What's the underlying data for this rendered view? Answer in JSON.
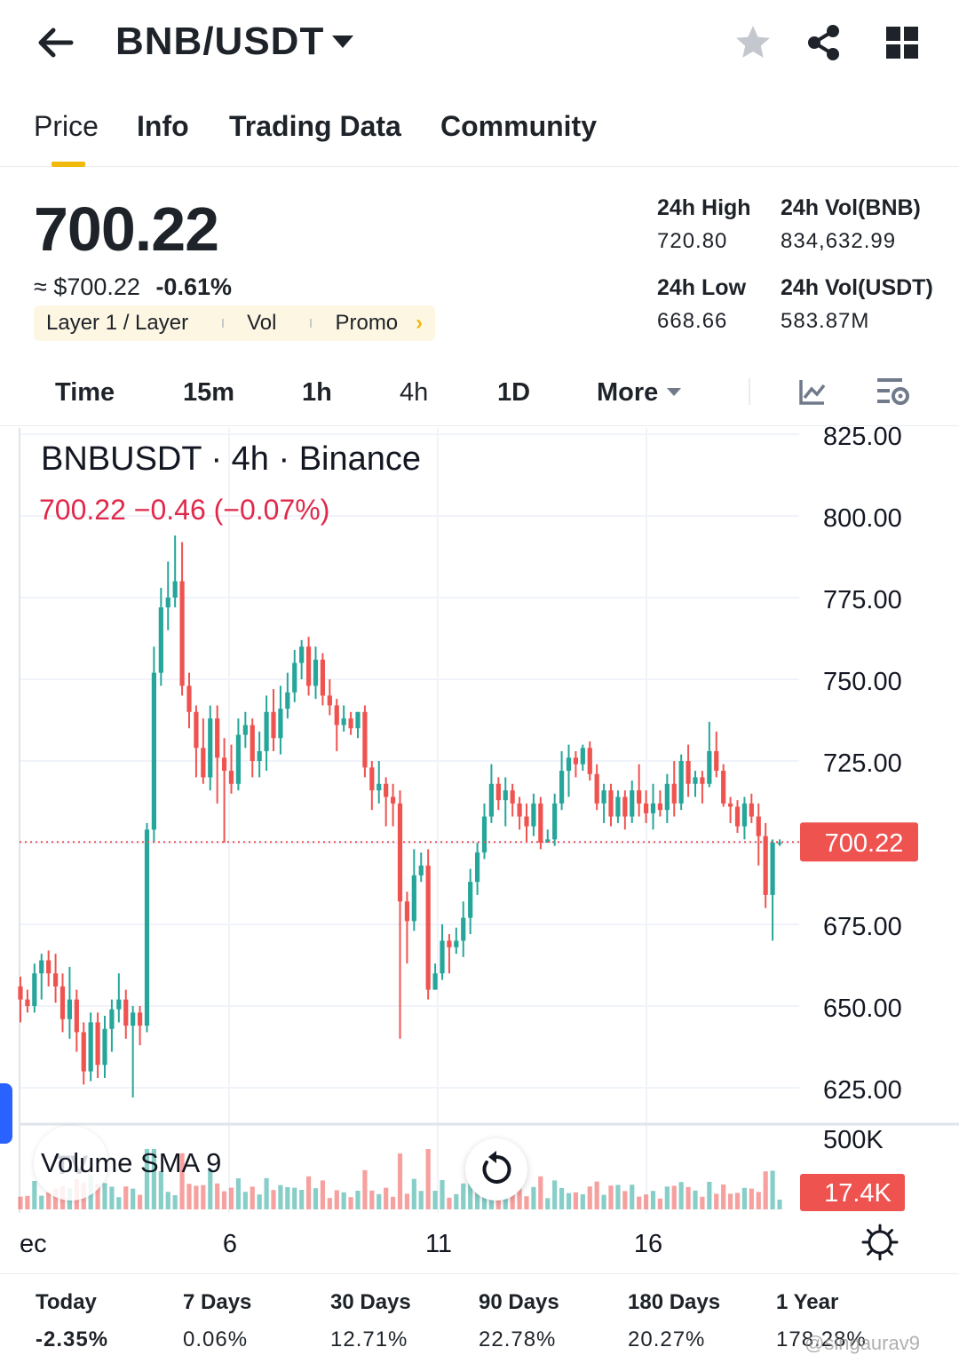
{
  "header": {
    "pair": "BNB/USDT",
    "icons": [
      "back-arrow-icon",
      "caret-down-icon",
      "star-icon",
      "share-icon",
      "grid-icon"
    ]
  },
  "tabs": [
    {
      "label": "Price",
      "active": true
    },
    {
      "label": "Info"
    },
    {
      "label": "Trading Data"
    },
    {
      "label": "Community"
    }
  ],
  "summary": {
    "last_price": "700.22",
    "fiat": "≈ $700.22",
    "change": "-0.61%",
    "tags": [
      "Layer 1 / Layer",
      "Vol",
      "Promo"
    ],
    "high_label": "24h High",
    "high": "720.80",
    "low_label": "24h Low",
    "low": "668.66",
    "vol_base_label": "24h Vol(BNB)",
    "vol_base": "834,632.99",
    "vol_quote_label": "24h Vol(USDT)",
    "vol_quote": "583.87M"
  },
  "intervals": [
    "Time",
    "15m",
    "1h",
    "4h",
    "1D",
    "More"
  ],
  "chart": {
    "title": "BNBUSDT · 4h · Binance",
    "quote": "700.22  −0.46 (−0.07%)",
    "volume_label": "Volume SMA 9",
    "up_color": "#26a69a",
    "down_color": "#ef5350",
    "price_tag": "700.22",
    "volume_tag": "17.4K"
  },
  "chart_data": {
    "type": "candlestick",
    "title": "BNBUSDT · 4h · Binance",
    "y_ticks": [
      "825.00",
      "800.00",
      "775.00",
      "750.00",
      "725.00",
      "700.00",
      "675.00",
      "650.00",
      "625.00"
    ],
    "ylim": [
      617,
      828
    ],
    "volume_ticks": [
      "500K"
    ],
    "x_ticks": [
      "ec",
      "6",
      "11",
      "16"
    ],
    "current_price": 700.22,
    "current_volume": "17.4K",
    "candles": [
      [
        656,
        652,
        659,
        645
      ],
      [
        652,
        650,
        655,
        648
      ],
      [
        650,
        660,
        663,
        648
      ],
      [
        660,
        664,
        666,
        652
      ],
      [
        664,
        660,
        667,
        656
      ],
      [
        660,
        656,
        666,
        651
      ],
      [
        656,
        646,
        660,
        642
      ],
      [
        646,
        652,
        662,
        640
      ],
      [
        652,
        642,
        655,
        636
      ],
      [
        642,
        630,
        645,
        626
      ],
      [
        630,
        645,
        648,
        627
      ],
      [
        645,
        632,
        648,
        628
      ],
      [
        632,
        643,
        647,
        628
      ],
      [
        643,
        649,
        652,
        636
      ],
      [
        649,
        652,
        660,
        645
      ],
      [
        652,
        644,
        655,
        640
      ],
      [
        644,
        648,
        650,
        622
      ],
      [
        648,
        644,
        650,
        638
      ],
      [
        644,
        704,
        706,
        642
      ],
      [
        704,
        752,
        760,
        700
      ],
      [
        752,
        772,
        778,
        748
      ],
      [
        772,
        775,
        786,
        765
      ],
      [
        775,
        780,
        794,
        772
      ],
      [
        780,
        748,
        792,
        745
      ],
      [
        748,
        740,
        752,
        735
      ],
      [
        740,
        729,
        742,
        720
      ],
      [
        729,
        720,
        738,
        718
      ],
      [
        720,
        738,
        742,
        716
      ],
      [
        738,
        726,
        742,
        712
      ],
      [
        726,
        722,
        732,
        700
      ],
      [
        722,
        718,
        730,
        715
      ],
      [
        718,
        733,
        738,
        716
      ],
      [
        733,
        736,
        740,
        729
      ],
      [
        736,
        725,
        738,
        720
      ],
      [
        725,
        728,
        734,
        720
      ],
      [
        728,
        740,
        745,
        722
      ],
      [
        740,
        732,
        747,
        728
      ],
      [
        732,
        741,
        748,
        727
      ],
      [
        741,
        746,
        752,
        738
      ],
      [
        746,
        755,
        759,
        743
      ],
      [
        755,
        760,
        762,
        750
      ],
      [
        760,
        748,
        763,
        745
      ],
      [
        748,
        756,
        760,
        744
      ],
      [
        756,
        745,
        758,
        742
      ],
      [
        745,
        742,
        750,
        739
      ],
      [
        742,
        736,
        744,
        728
      ],
      [
        736,
        738,
        742,
        734
      ],
      [
        738,
        735,
        740,
        733
      ],
      [
        735,
        740,
        740,
        732
      ],
      [
        740,
        723,
        742,
        720
      ],
      [
        723,
        716,
        725,
        710
      ],
      [
        716,
        718,
        725,
        712
      ],
      [
        718,
        714,
        720,
        705
      ],
      [
        714,
        712,
        718,
        705
      ],
      [
        712,
        682,
        716,
        640
      ],
      [
        682,
        676,
        685,
        663
      ],
      [
        676,
        690,
        698,
        673
      ],
      [
        690,
        693,
        697,
        688
      ],
      [
        693,
        655,
        698,
        652
      ],
      [
        655,
        660,
        663,
        655
      ],
      [
        660,
        670,
        675,
        658
      ],
      [
        670,
        668,
        672,
        660
      ],
      [
        668,
        670,
        674,
        666
      ],
      [
        670,
        677,
        682,
        665
      ],
      [
        677,
        688,
        692,
        672
      ],
      [
        688,
        697,
        700,
        684
      ],
      [
        697,
        708,
        712,
        695
      ],
      [
        708,
        718,
        724,
        706
      ],
      [
        718,
        713,
        720,
        710
      ],
      [
        713,
        716,
        720,
        705
      ],
      [
        716,
        712,
        718,
        708
      ],
      [
        712,
        708,
        714,
        704
      ],
      [
        708,
        705,
        712,
        700
      ],
      [
        705,
        712,
        715,
        702
      ],
      [
        712,
        700,
        714,
        698
      ],
      [
        700,
        701,
        704,
        700
      ],
      [
        701,
        712,
        715,
        699
      ],
      [
        712,
        722,
        728,
        710
      ],
      [
        722,
        726,
        730,
        714
      ],
      [
        726,
        724,
        728,
        720
      ],
      [
        724,
        729,
        730,
        722
      ],
      [
        729,
        721,
        731,
        719
      ],
      [
        721,
        712,
        724,
        710
      ],
      [
        712,
        716,
        718,
        706
      ],
      [
        716,
        708,
        718,
        705
      ],
      [
        708,
        714,
        716,
        706
      ],
      [
        714,
        708,
        716,
        704
      ],
      [
        708,
        716,
        719,
        706
      ],
      [
        716,
        712,
        724,
        708
      ],
      [
        712,
        709,
        716,
        706
      ],
      [
        709,
        712,
        718,
        704
      ],
      [
        712,
        710,
        716,
        708
      ],
      [
        710,
        718,
        721,
        706
      ],
      [
        718,
        712,
        725,
        708
      ],
      [
        712,
        725,
        727,
        710
      ],
      [
        725,
        718,
        730,
        714
      ],
      [
        718,
        720,
        722,
        714
      ],
      [
        720,
        718,
        722,
        712
      ],
      [
        718,
        728,
        737,
        717
      ],
      [
        728,
        722,
        734,
        720
      ],
      [
        722,
        712,
        724,
        711
      ],
      [
        712,
        711,
        714,
        706
      ],
      [
        711,
        705,
        713,
        703
      ],
      [
        705,
        712,
        714,
        701
      ],
      [
        712,
        708,
        715,
        706
      ],
      [
        708,
        702,
        712,
        693
      ],
      [
        702,
        684,
        706,
        680
      ],
      [
        684,
        700,
        701,
        670
      ],
      [
        700,
        700,
        701,
        699
      ]
    ],
    "volume_shown": "bars beneath price, unlabeled heights"
  },
  "performance": [
    {
      "label": "Today",
      "value": "-2.35%"
    },
    {
      "label": "7 Days",
      "value": "0.06%"
    },
    {
      "label": "30 Days",
      "value": "12.71%"
    },
    {
      "label": "90 Days",
      "value": "22.78%"
    },
    {
      "label": "180 Days",
      "value": "20.27%"
    },
    {
      "label": "1 Year",
      "value": "178.28%"
    }
  ],
  "watermark": "@singaurav9"
}
